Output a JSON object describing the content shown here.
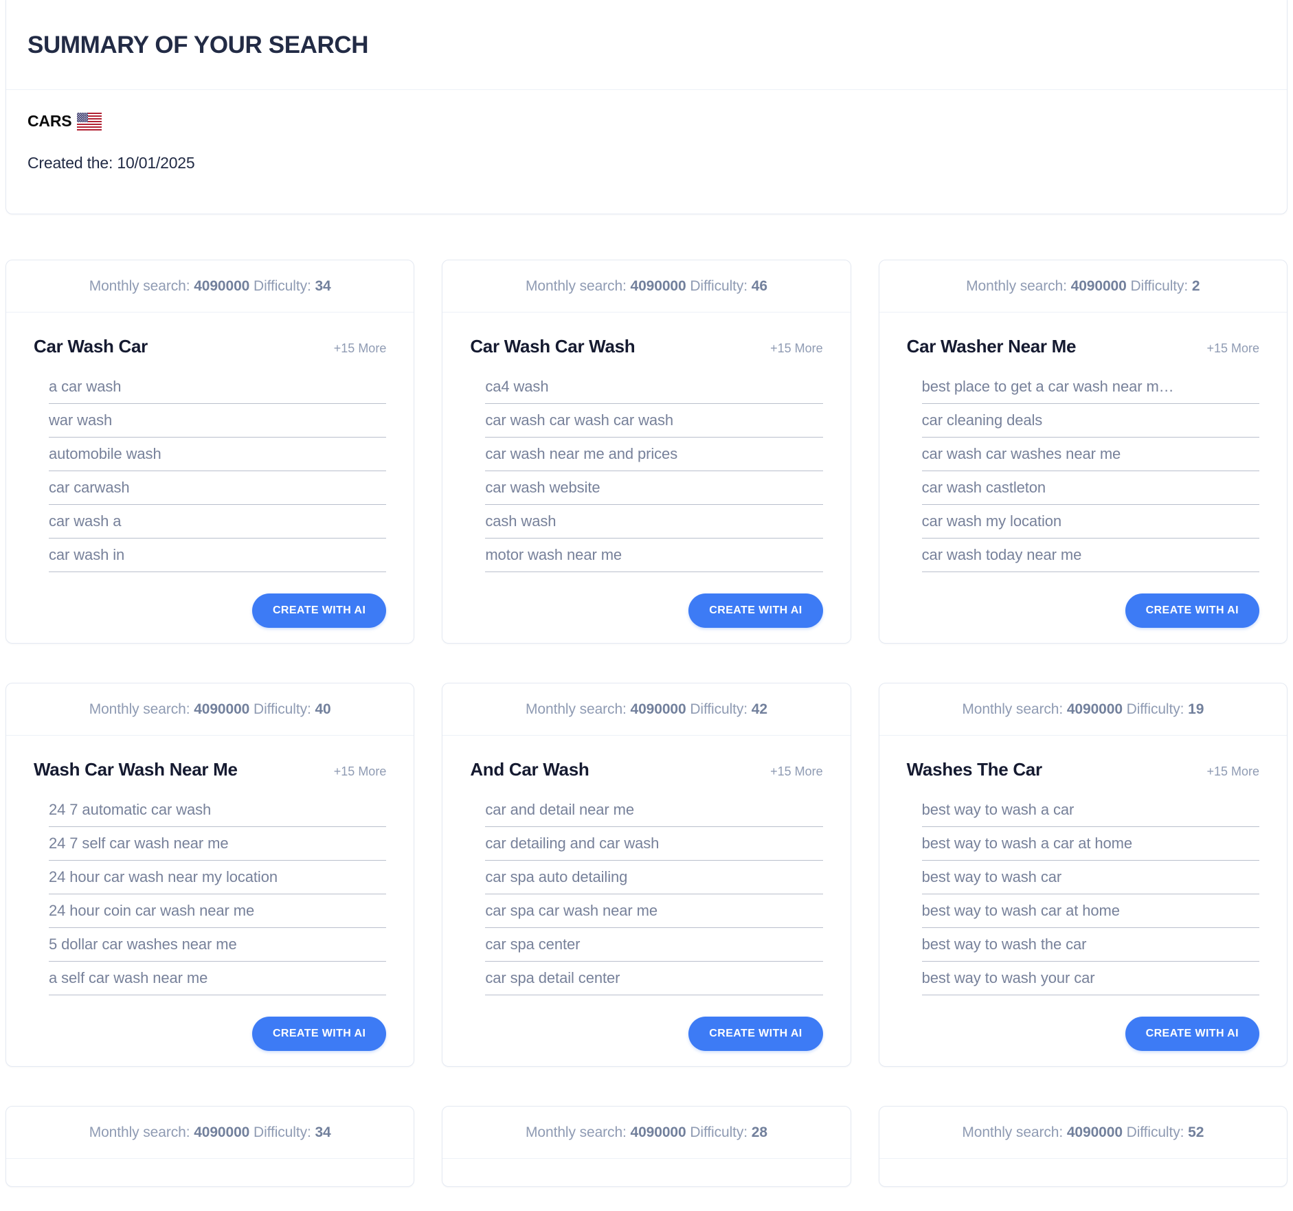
{
  "page": {
    "title": "SUMMARY OF YOUR SEARCH",
    "project_name": "CARS",
    "flag_icon": "us-flag-icon",
    "created_label": "Created the: 10/01/2025"
  },
  "labels": {
    "monthly_search_prefix": "Monthly search:",
    "difficulty_prefix": "Difficulty:",
    "more_suffix": "+15 More",
    "create_button": "CREATE WITH AI"
  },
  "colors": {
    "accent": "#3d7bf5",
    "title": "#222b45",
    "muted": "#8f9bb3",
    "list_text": "#77819a",
    "border": "#e4e9f2"
  },
  "cards": [
    {
      "monthly_search": "4090000",
      "difficulty": "34",
      "title": "Car Wash Car",
      "more": "+15 More",
      "button": "CREATE WITH AI",
      "keywords": [
        "a car wash",
        "war wash",
        "automobile wash",
        "car carwash",
        "car wash a",
        "car wash in"
      ]
    },
    {
      "monthly_search": "4090000",
      "difficulty": "46",
      "title": "Car Wash Car Wash",
      "more": "+15 More",
      "button": "CREATE WITH AI",
      "keywords": [
        "ca4 wash",
        "car wash car wash car wash",
        "car wash near me and prices",
        "car wash website",
        "cash wash",
        "motor wash near me"
      ]
    },
    {
      "monthly_search": "4090000",
      "difficulty": "2",
      "title": "Car Washer Near Me",
      "more": "+15 More",
      "button": "CREATE WITH AI",
      "keywords": [
        "best place to get a car wash near m…",
        "car cleaning deals",
        "car wash car washes near me",
        "car wash castleton",
        "car wash my location",
        "car wash today near me"
      ]
    },
    {
      "monthly_search": "4090000",
      "difficulty": "40",
      "title": "Wash Car Wash Near Me",
      "more": "+15 More",
      "button": "CREATE WITH AI",
      "keywords": [
        "24 7 automatic car wash",
        "24 7 self car wash near me",
        "24 hour car wash near my location",
        "24 hour coin car wash near me",
        "5 dollar car washes near me",
        "a self car wash near me"
      ]
    },
    {
      "monthly_search": "4090000",
      "difficulty": "42",
      "title": "And Car Wash",
      "more": "+15 More",
      "button": "CREATE WITH AI",
      "keywords": [
        "car and detail near me",
        "car detailing and car wash",
        "car spa auto detailing",
        "car spa car wash near me",
        "car spa center",
        "car spa detail center"
      ]
    },
    {
      "monthly_search": "4090000",
      "difficulty": "19",
      "title": "Washes The Car",
      "more": "+15 More",
      "button": "CREATE WITH AI",
      "keywords": [
        "best way to wash a car",
        "best way to wash a car at home",
        "best way to wash car",
        "best way to wash car at home",
        "best way to wash the car",
        "best way to wash your car"
      ]
    },
    {
      "monthly_search": "4090000",
      "difficulty": "34",
      "title": "",
      "more": "",
      "button": "",
      "keywords": []
    },
    {
      "monthly_search": "4090000",
      "difficulty": "28",
      "title": "",
      "more": "",
      "button": "",
      "keywords": []
    },
    {
      "monthly_search": "4090000",
      "difficulty": "52",
      "title": "",
      "more": "",
      "button": "",
      "keywords": []
    }
  ]
}
